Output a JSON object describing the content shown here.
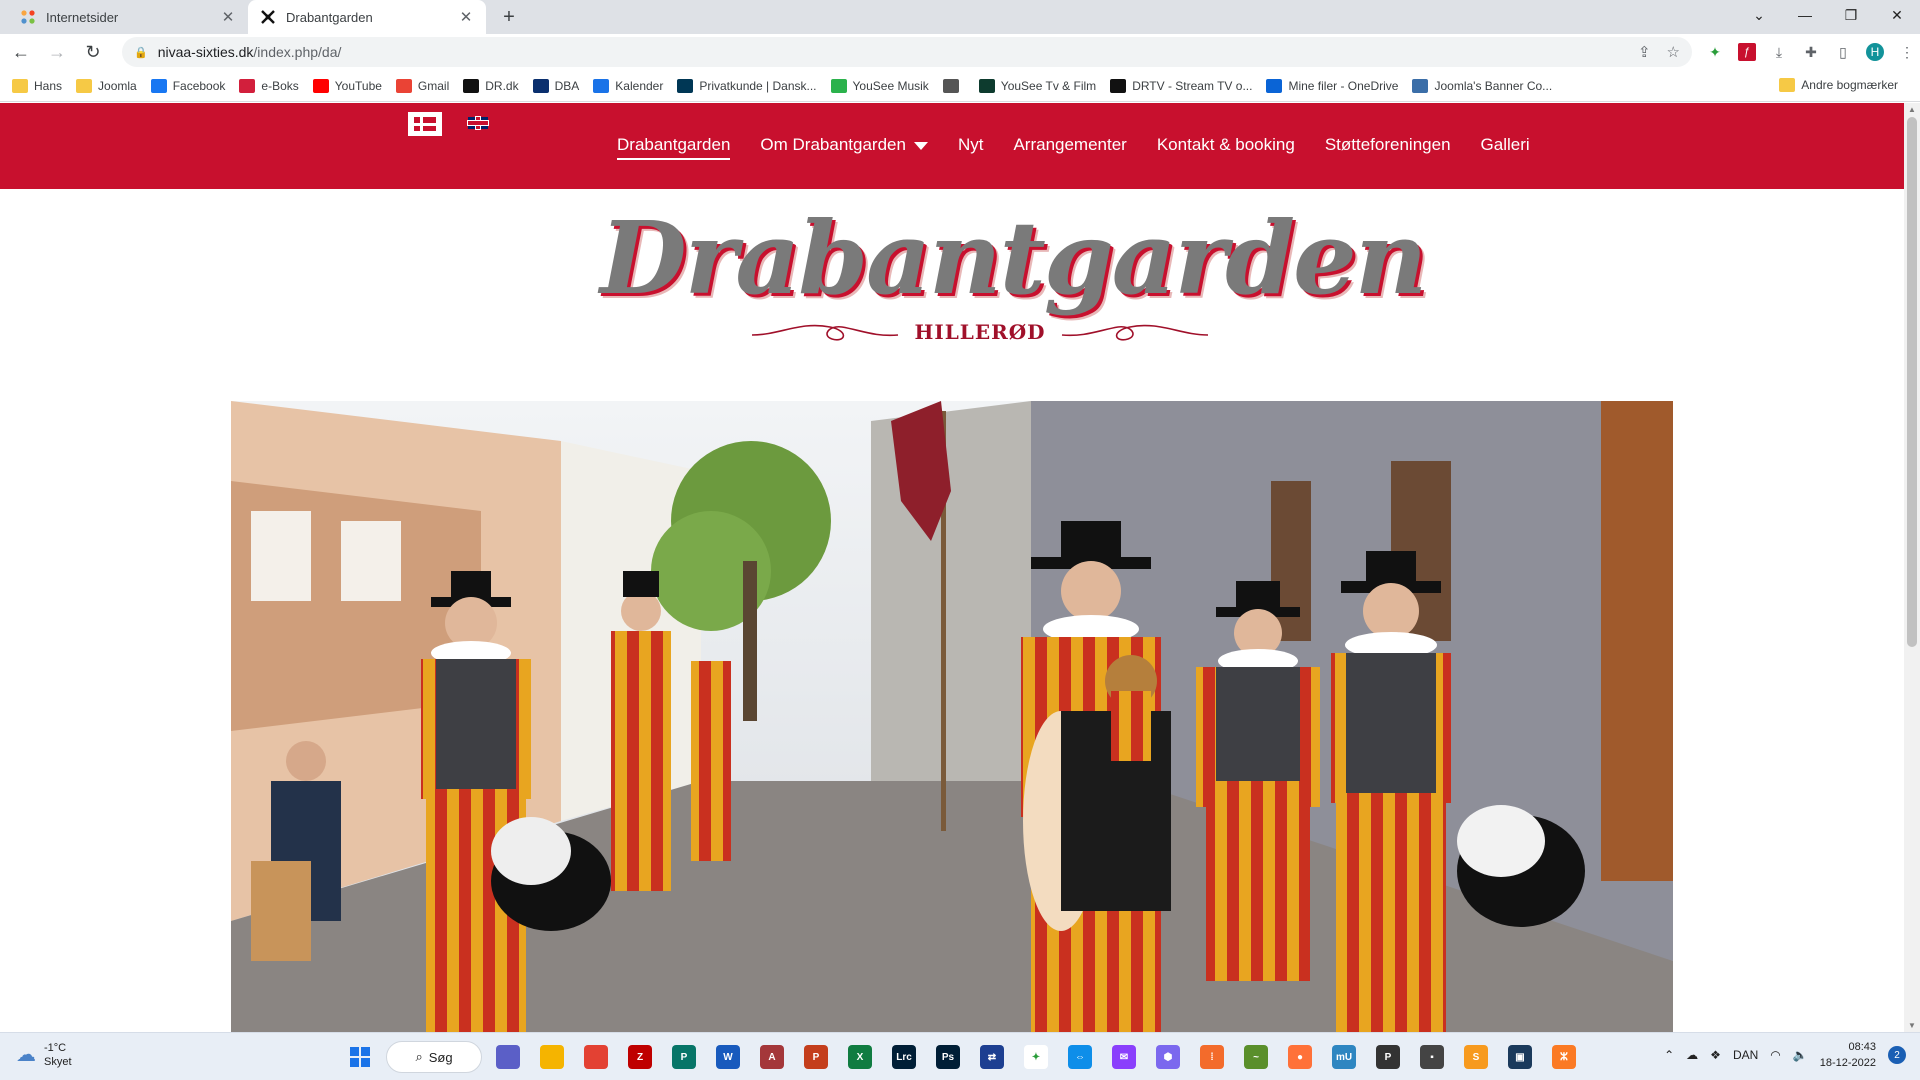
{
  "browser": {
    "tabs": [
      {
        "title": "Internetsider",
        "active": false
      },
      {
        "title": "Drabantgarden",
        "active": true
      }
    ],
    "address": {
      "domain": "nivaa-sixties.dk",
      "path": "/index.php/da/"
    },
    "bookmarks": [
      {
        "label": "Hans",
        "icon": "folder-icon",
        "color": "#f6c945"
      },
      {
        "label": "Joomla",
        "icon": "folder-icon",
        "color": "#f6c945"
      },
      {
        "label": "Facebook",
        "icon": "facebook-icon",
        "color": "#1877f2"
      },
      {
        "label": "e-Boks",
        "icon": "eboks-icon",
        "color": "#d21f3c"
      },
      {
        "label": "YouTube",
        "icon": "youtube-icon",
        "color": "#ff0000"
      },
      {
        "label": "Gmail",
        "icon": "gmail-icon",
        "color": "#ea4335"
      },
      {
        "label": "DR.dk",
        "icon": "dr-icon",
        "color": "#111111"
      },
      {
        "label": "DBA",
        "icon": "dba-icon",
        "color": "#0a2f6e"
      },
      {
        "label": "Kalender",
        "icon": "calendar-icon",
        "color": "#1a73e8"
      },
      {
        "label": "Privatkunde | Dansk...",
        "icon": "bank-icon",
        "color": "#003755"
      },
      {
        "label": "YouSee Musik",
        "icon": "music-icon",
        "color": "#2bb24c"
      },
      {
        "label": "",
        "icon": "globe-icon",
        "color": "#555555"
      },
      {
        "label": "YouSee Tv & Film",
        "icon": "tv-icon",
        "color": "#0d3b2e"
      },
      {
        "label": "DRTV - Stream TV o...",
        "icon": "dr-icon",
        "color": "#111111"
      },
      {
        "label": "Mine filer - OneDrive",
        "icon": "onedrive-icon",
        "color": "#0a64d6"
      },
      {
        "label": "Joomla's Banner Co...",
        "icon": "shield-icon",
        "color": "#3b6ea8"
      }
    ],
    "other_bookmarks": "Andre bogmærker",
    "profile_initial": "H"
  },
  "site": {
    "nav": [
      "Drabantgarden",
      "Om Drabantgarden",
      "Nyt",
      "Arrangementer",
      "Kontakt & booking",
      "Støtteforeningen",
      "Galleri"
    ],
    "logo_title": "Drabantgarden",
    "logo_subtitle": "HILLERØD",
    "brand_color": "#c8102e"
  },
  "taskbar": {
    "weather_temp": "-1°C",
    "weather_desc": "Skyet",
    "search_label": "Søg",
    "language": "DAN",
    "time": "08:43",
    "date": "18-12-2022",
    "notifications": "2",
    "apps": [
      {
        "name": "teams-icon",
        "label": "",
        "color": "#5b5fc7"
      },
      {
        "name": "file-explorer-icon",
        "label": "",
        "color": "#f5b400"
      },
      {
        "name": "chrome-icon",
        "label": "",
        "color": "#e34133"
      },
      {
        "name": "filezilla-icon",
        "label": "Z",
        "color": "#bf0000"
      },
      {
        "name": "publisher-icon",
        "label": "P",
        "color": "#077568"
      },
      {
        "name": "word-icon",
        "label": "W",
        "color": "#185abd"
      },
      {
        "name": "access-icon",
        "label": "A",
        "color": "#a4373a"
      },
      {
        "name": "powerpoint-icon",
        "label": "P",
        "color": "#c43e1c"
      },
      {
        "name": "excel-icon",
        "label": "X",
        "color": "#107c41"
      },
      {
        "name": "lightroom-icon",
        "label": "Lrc",
        "color": "#001e36"
      },
      {
        "name": "photoshop-icon",
        "label": "Ps",
        "color": "#001e36"
      },
      {
        "name": "sync-icon",
        "label": "⇄",
        "color": "#1d3f91"
      },
      {
        "name": "pinwheel-icon",
        "label": "✦",
        "color": "#ffffff"
      },
      {
        "name": "teamviewer-icon",
        "label": "⇔",
        "color": "#0e8ee9"
      },
      {
        "name": "messenger-icon",
        "label": "✉",
        "color": "#8a3ffc"
      },
      {
        "name": "hexagon-icon",
        "label": "⬢",
        "color": "#7b68ee"
      },
      {
        "name": "office-icon",
        "label": "⁞",
        "color": "#f36b2b"
      },
      {
        "name": "chart-app-icon",
        "label": "~",
        "color": "#5a8f2b"
      },
      {
        "name": "firefox-icon",
        "label": "●",
        "color": "#ff7139"
      },
      {
        "name": "mu-icon",
        "label": "mU",
        "color": "#2e86c1"
      },
      {
        "name": "ps-dark-icon",
        "label": "P",
        "color": "#333333"
      },
      {
        "name": "dark-app-icon",
        "label": "▪",
        "color": "#444444"
      },
      {
        "name": "sublime-icon",
        "label": "S",
        "color": "#f79a1e"
      },
      {
        "name": "screen-app-icon",
        "label": "▣",
        "color": "#1b3a5c"
      },
      {
        "name": "xampp-icon",
        "label": "ⵣ",
        "color": "#fb7a24"
      }
    ]
  }
}
